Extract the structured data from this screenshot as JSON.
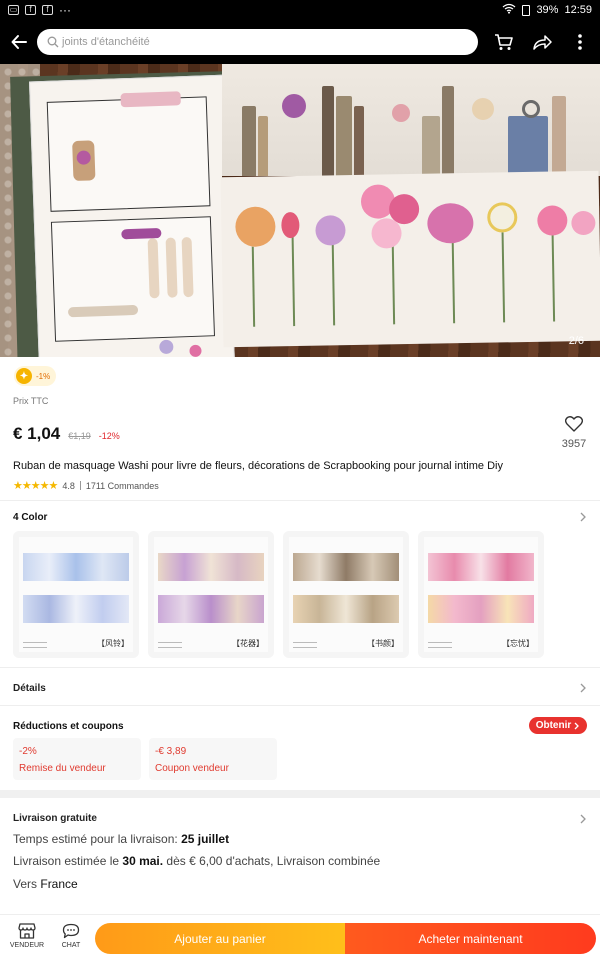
{
  "status_bar": {
    "battery": "39%",
    "time": "12:59"
  },
  "search": {
    "placeholder": "joints d'étanchéité"
  },
  "gallery": {
    "indicator": "2/6"
  },
  "badge": {
    "value": "-1%"
  },
  "price": {
    "prefix": "Prix TTC",
    "current": "€ 1,04",
    "original": "€1,19",
    "discount": "-12%"
  },
  "wishlist": {
    "count": "3957"
  },
  "product": {
    "title": "Ruban de masquage Washi pour livre de fleurs, décorations de Scrapbooking pour journal intime Diy",
    "rating": "4.8",
    "orders": "1711 Commandes"
  },
  "variants": {
    "title": "4 Color",
    "items": [
      {
        "label": "【风铃】"
      },
      {
        "label": "【花器】"
      },
      {
        "label": "【书颜】"
      },
      {
        "label": "【忘忧】"
      }
    ]
  },
  "details": {
    "label": "Détails"
  },
  "coupons": {
    "title": "Réductions et coupons",
    "obtain_label": "Obtenir",
    "items": [
      {
        "value": "-2%",
        "label": "Remise du vendeur"
      },
      {
        "value": "-€ 3,89",
        "label": "Coupon vendeur"
      }
    ]
  },
  "shipping": {
    "title": "Livraison gratuite",
    "estimate_prefix": "Temps estimé pour la livraison: ",
    "estimate_date": "25 juillet",
    "line2_prefix": "Livraison estimée le ",
    "line2_date": "30 mai.",
    "line2_suffix": " dès € 6,00 d'achats, Livraison combinée",
    "to_prefix": "Vers ",
    "to_country": "France"
  },
  "bottom_bar": {
    "vendor_label": "VENDEUR",
    "chat_label": "CHAT",
    "add_to_cart": "Ajouter au panier",
    "buy_now": "Acheter maintenant"
  }
}
